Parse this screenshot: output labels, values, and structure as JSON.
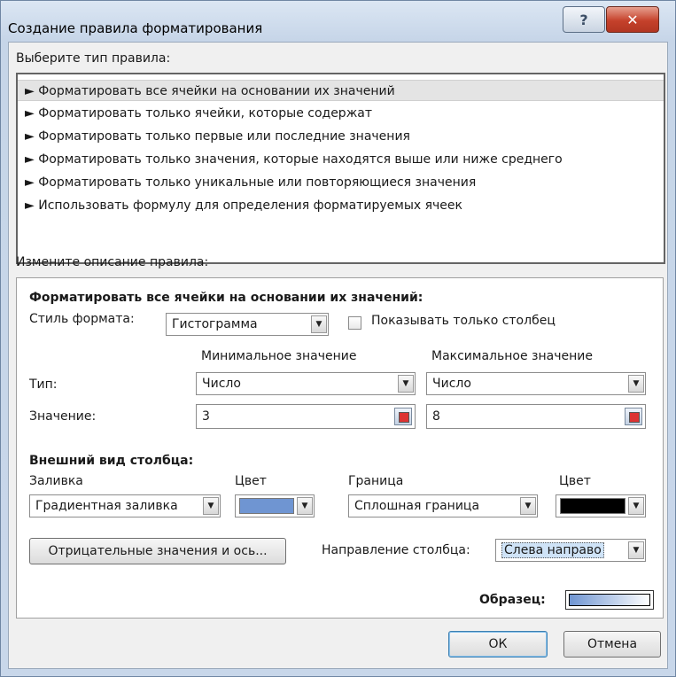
{
  "window": {
    "title": "Создание правила форматирования"
  },
  "rule_types": {
    "label": "Выберите тип правила:",
    "items": [
      "► Форматировать все ячейки на основании их значений",
      "► Форматировать только ячейки, которые содержат",
      "► Форматировать только первые или последние значения",
      "► Форматировать только значения, которые находятся выше или ниже среднего",
      "► Форматировать только уникальные или повторяющиеся значения",
      "► Использовать формулу для определения форматируемых ячеек"
    ],
    "selected_index": 0
  },
  "description": {
    "label": "Измените описание правила:",
    "heading": "Форматировать все ячейки на основании их значений:",
    "format_style_label": "Стиль формата:",
    "format_style_value": "Гистограмма",
    "show_bar_only_label": "Показывать только столбец",
    "show_bar_only_checked": false,
    "min_header": "Минимальное значение",
    "max_header": "Максимальное значение",
    "type_label": "Тип:",
    "value_label": "Значение:",
    "min_type": "Число",
    "max_type": "Число",
    "min_value": "3",
    "max_value": "8",
    "bar_appearance_heading": "Внешний вид столбца:",
    "fill_label": "Заливка",
    "fill_value": "Градиентная заливка",
    "fill_color_label": "Цвет",
    "fill_color": "#6f95d2",
    "border_label": "Граница",
    "border_value": "Сплошная граница",
    "border_color_label": "Цвет",
    "border_color": "#000000",
    "negative_button": "Отрицательные значения и ось...",
    "direction_label": "Направление столбца:",
    "direction_value": "Слева направо",
    "preview_label": "Образец:"
  },
  "buttons": {
    "ok": "ОК",
    "cancel": "Отмена"
  }
}
